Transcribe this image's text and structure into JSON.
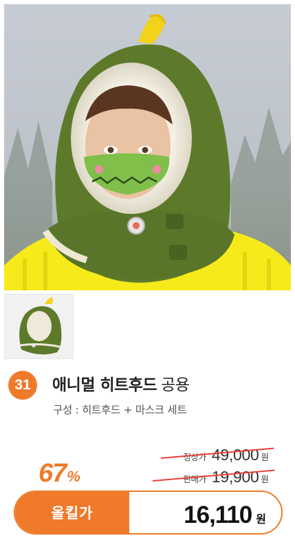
{
  "product": {
    "rank": "31",
    "name_bold": "애니멀 히트후드",
    "name_light": "공용",
    "composition": "구성 : 히트후드 + 마스크 세트"
  },
  "pricing": {
    "regular_label": "정상가",
    "regular_price": "49,000",
    "sale_label": "판매가",
    "sale_price": "19,900",
    "currency": "원",
    "discount_value": "67",
    "discount_sign": "%",
    "final_label": "올킬가",
    "final_price": "16,110",
    "final_currency": "원"
  },
  "colors": {
    "accent": "#ef7a2a",
    "strike": "#e8403a",
    "hood_green": "#5d7a2a",
    "sweater_yellow": "#f6ea1a"
  }
}
